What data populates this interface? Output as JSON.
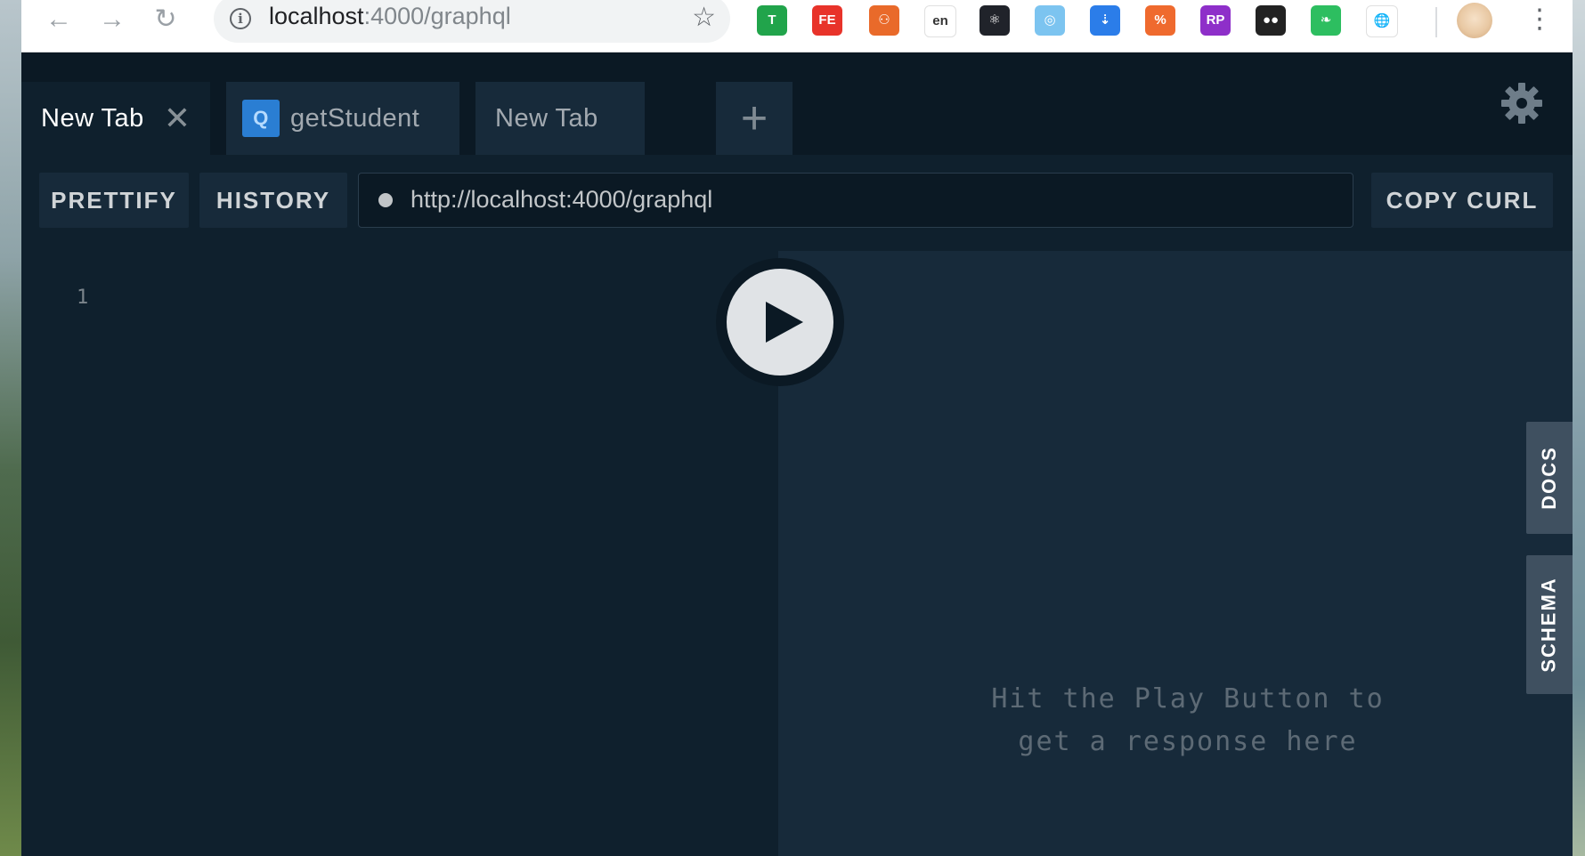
{
  "browser": {
    "url_host": "localhost",
    "url_path": ":4000/graphql",
    "nav": {
      "back": "←",
      "forward": "→",
      "reload": "↻"
    },
    "star_icon": "☆",
    "info_icon": "i",
    "kebab": "⋮",
    "extensions": [
      {
        "name": "shield-extension-icon",
        "text": "T",
        "color": "#21a44b"
      },
      {
        "name": "fe-extension-icon",
        "text": "FE",
        "color": "#e8332a"
      },
      {
        "name": "sitemap-extension-icon",
        "text": "⚇",
        "color": "#e96a2a"
      },
      {
        "name": "translate-extension-icon",
        "text": "en",
        "color": "#ffffff"
      },
      {
        "name": "react-devtools-icon",
        "text": "⚛",
        "color": "#20232a"
      },
      {
        "name": "target-extension-icon",
        "text": "◎",
        "color": "#7cc4f0"
      },
      {
        "name": "save-extension-icon",
        "text": "⇣",
        "color": "#2b7de9"
      },
      {
        "name": "orange-extension-icon",
        "text": "%",
        "color": "#ef6a2e"
      },
      {
        "name": "rp-extension-icon",
        "text": "RP",
        "color": "#8e2fc9"
      },
      {
        "name": "glasses-extension-icon",
        "text": "●●",
        "color": "#222222"
      },
      {
        "name": "evernote-extension-icon",
        "text": "❧",
        "color": "#2dbe60"
      },
      {
        "name": "globe-extension-icon",
        "text": "🌐",
        "color": "#ffffff"
      }
    ]
  },
  "tabs": [
    {
      "label": "New Tab",
      "active": true,
      "close": "✕"
    },
    {
      "label": "getStudent",
      "badge": "Q"
    },
    {
      "label": "New Tab"
    }
  ],
  "add_tab": "+",
  "controls": {
    "prettify": "PRETTIFY",
    "history": "HISTORY",
    "endpoint": "http://localhost:4000/graphql",
    "copy_curl": "COPY CURL"
  },
  "editor": {
    "line_number": "1"
  },
  "result": {
    "hint_line1": "Hit the Play Button to",
    "hint_line2": "get a response here"
  },
  "side_tabs": {
    "docs": "DOCS",
    "schema": "SCHEMA"
  }
}
